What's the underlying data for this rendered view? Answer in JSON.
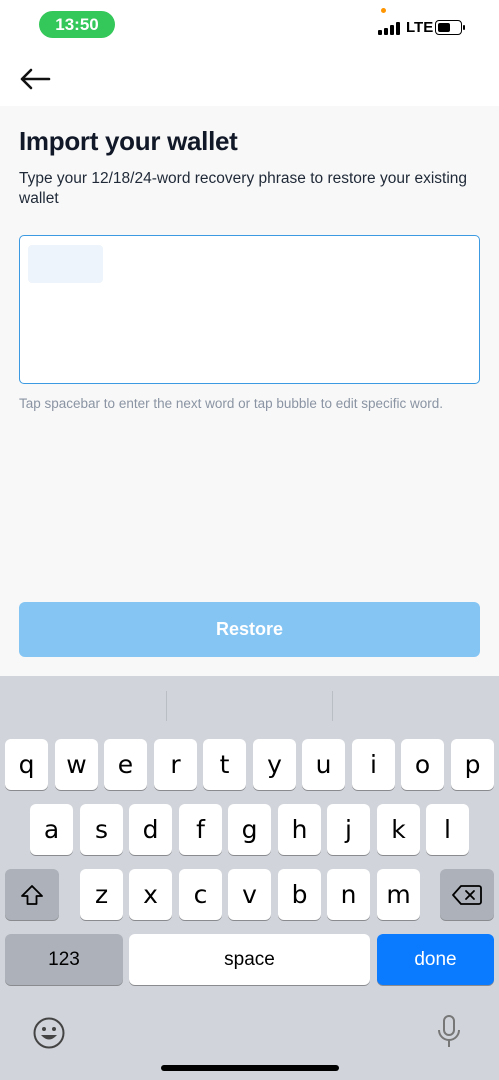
{
  "status_bar": {
    "time": "13:50",
    "network": "LTE",
    "colors": {
      "time_pill": "#34c759",
      "privacy_dot": "#ff9500"
    }
  },
  "header": {
    "back_icon": "arrow-left-icon"
  },
  "main": {
    "title": "Import your wallet",
    "subtitle": "Type your 12/18/24-word recovery phrase to restore your existing wallet",
    "phrase_input_value": "",
    "hint": "Tap spacebar to enter the next word or tap bubble to edit specific word.",
    "restore_label": "Restore",
    "colors": {
      "input_border": "#3b9ae1",
      "restore_button": "#84c5f4"
    }
  },
  "keyboard": {
    "row1": [
      "q",
      "w",
      "e",
      "r",
      "t",
      "y",
      "u",
      "i",
      "o",
      "p"
    ],
    "row2": [
      "a",
      "s",
      "d",
      "f",
      "g",
      "h",
      "j",
      "k",
      "l"
    ],
    "row3": [
      "z",
      "x",
      "c",
      "v",
      "b",
      "n",
      "m"
    ],
    "numbers_label": "123",
    "space_label": "space",
    "done_label": "done",
    "icons": [
      "shift-icon",
      "backspace-icon",
      "emoji-icon",
      "microphone-icon"
    ],
    "colors": {
      "done_key": "#0a7aff"
    }
  }
}
